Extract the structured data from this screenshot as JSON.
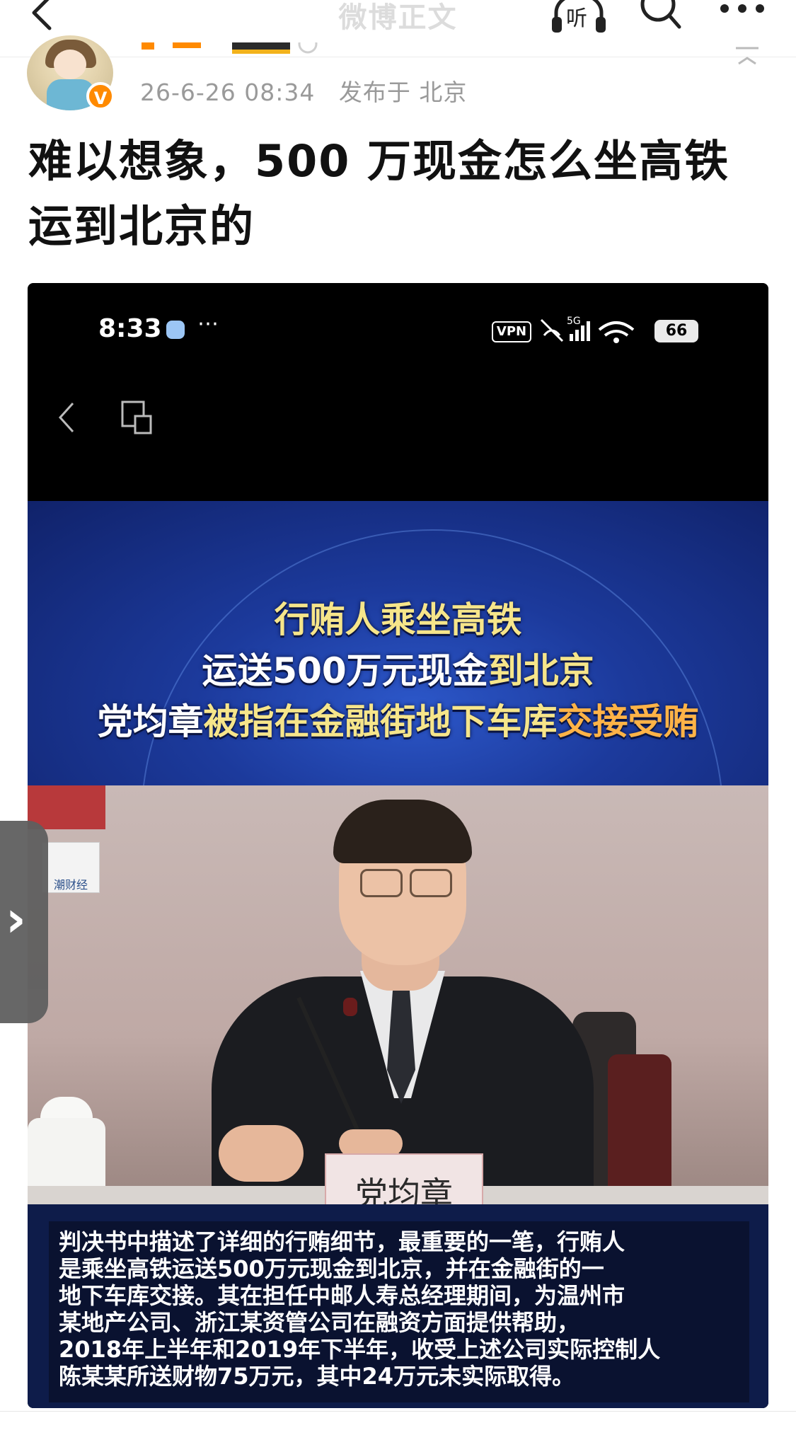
{
  "nav": {
    "title": "微博正文",
    "listen_label": "听"
  },
  "post": {
    "author_badge": "V",
    "time": "26-6-26 08:34",
    "location": "发布于 北京",
    "headline": "难以想象，500 万现金怎么坐高铁运到北京的"
  },
  "media": {
    "status_time": "8:33",
    "vpn": "VPN",
    "network": "5G",
    "battery": "66",
    "banner": {
      "line1": "行贿人乘坐高铁",
      "line2_a": "运送500万元现金",
      "line2_b": "到北京",
      "line3_a": "党均章",
      "line3_b": "被指在金融街地下车库",
      "line3_c": "交接受贿"
    },
    "watermark": "潮财经",
    "nameplate": "党均章",
    "caption_lines": [
      "判决书中描述了详细的行贿细节，最重要的一笔，行贿人",
      "是乘坐高铁运送500万元现金到北京，并在金融街的一",
      "地下车库交接。其在担任中邮人寿总经理期间，为温州市",
      "某地产公司、浙江某资管公司在融资方面提供帮助，",
      "2018年上半年和2019年下半年，收受上述公司实际控制人",
      "陈某某所送财物75万元，其中24万元未实际取得。"
    ]
  },
  "colors": {
    "banner_gold": "#f6e58a",
    "banner_orange": "#ffb347",
    "badge_orange": "#ff8a00"
  }
}
